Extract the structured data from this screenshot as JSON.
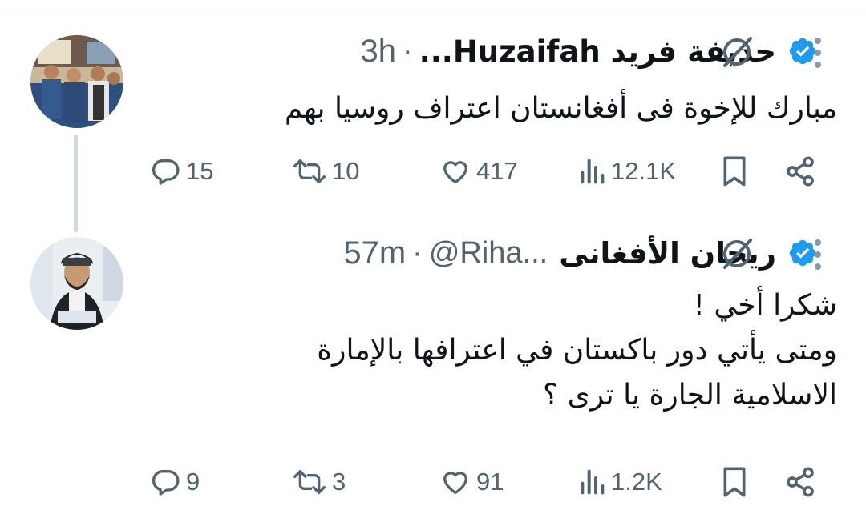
{
  "tweets": [
    {
      "display_name": "حذيفة فريد Huzaifah...",
      "time": "3h",
      "body": [
        "مبارك للإخوة فى أفغانستان اعتراف روسيا بهم"
      ],
      "actions": {
        "replies": "15",
        "reposts": "10",
        "likes": "417",
        "views": "12.1K"
      }
    },
    {
      "display_name": "ريحان الأفغانى",
      "handle": "@Riha...",
      "time": "57m",
      "body": [
        "شكرا أخي !",
        "ومتى يأتي دور باكستان في اعترافها بالإمارة",
        "الاسلامية الجارة يا ترى ؟"
      ],
      "actions": {
        "replies": "9",
        "reposts": "3",
        "likes": "91",
        "views": "1.2K"
      }
    }
  ],
  "colors": {
    "verified": "#1d9bf0",
    "muted": "#536471",
    "text": "#0f1419",
    "thread_line": "#cfd9de"
  },
  "icons": [
    "verified-badge-icon",
    "grok-icon",
    "more-icon",
    "reply-icon",
    "repost-icon",
    "like-icon",
    "views-icon",
    "bookmark-icon",
    "share-icon"
  ]
}
